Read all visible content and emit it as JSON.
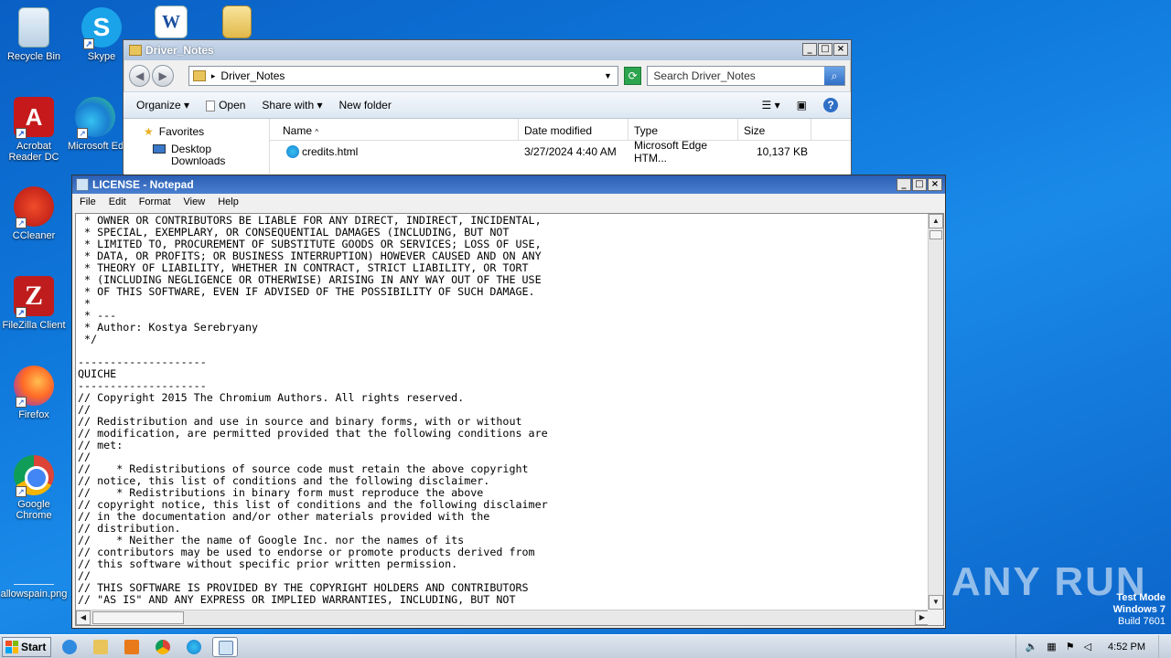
{
  "desktop": {
    "icons": [
      {
        "label": "Recycle Bin",
        "icon": "recycle-bin-icon"
      },
      {
        "label": "Skype",
        "icon": "skype-icon"
      },
      {
        "label": "Acrobat Reader DC",
        "icon": "acrobat-icon"
      },
      {
        "label": "Microsoft Edge",
        "icon": "edge-icon"
      },
      {
        "label": "CCleaner",
        "icon": "ccleaner-icon"
      },
      {
        "label": "FileZilla Client",
        "icon": "filezilla-icon"
      },
      {
        "label": "Firefox",
        "icon": "firefox-icon"
      },
      {
        "label": "Google Chrome",
        "icon": "chrome-icon"
      },
      {
        "label": "allowspain.png",
        "icon": "image-file-icon"
      }
    ],
    "edge_label_visible": "Microsoft Ed"
  },
  "explorer": {
    "title": "Driver_Notes",
    "address": "Driver_Notes",
    "search_placeholder": "Search Driver_Notes",
    "toolbar": {
      "organize": "Organize",
      "open": "Open",
      "share_with": "Share with",
      "new_folder": "New folder"
    },
    "nav": {
      "favorites": "Favorites",
      "desktop": "Desktop",
      "downloads": "Downloads"
    },
    "columns": {
      "name": "Name",
      "date_modified": "Date modified",
      "type": "Type",
      "size": "Size"
    },
    "files": [
      {
        "name": "credits.html",
        "date": "3/27/2024 4:40 AM",
        "type": "Microsoft Edge HTM...",
        "size": "10,137 KB"
      }
    ]
  },
  "notepad": {
    "title": "LICENSE - Notepad",
    "menu": {
      "file": "File",
      "edit": "Edit",
      "format": "Format",
      "view": "View",
      "help": "Help"
    },
    "content": " * OWNER OR CONTRIBUTORS BE LIABLE FOR ANY DIRECT, INDIRECT, INCIDENTAL,\n * SPECIAL, EXEMPLARY, OR CONSEQUENTIAL DAMAGES (INCLUDING, BUT NOT\n * LIMITED TO, PROCUREMENT OF SUBSTITUTE GOODS OR SERVICES; LOSS OF USE,\n * DATA, OR PROFITS; OR BUSINESS INTERRUPTION) HOWEVER CAUSED AND ON ANY\n * THEORY OF LIABILITY, WHETHER IN CONTRACT, STRICT LIABILITY, OR TORT\n * (INCLUDING NEGLIGENCE OR OTHERWISE) ARISING IN ANY WAY OUT OF THE USE\n * OF THIS SOFTWARE, EVEN IF ADVISED OF THE POSSIBILITY OF SUCH DAMAGE.\n *\n * ---\n * Author: Kostya Serebryany\n */\n\n--------------------\nQUICHE\n--------------------\n// Copyright 2015 The Chromium Authors. All rights reserved.\n//\n// Redistribution and use in source and binary forms, with or without\n// modification, are permitted provided that the following conditions are\n// met:\n//\n//    * Redistributions of source code must retain the above copyright\n// notice, this list of conditions and the following disclaimer.\n//    * Redistributions in binary form must reproduce the above\n// copyright notice, this list of conditions and the following disclaimer\n// in the documentation and/or other materials provided with the\n// distribution.\n//    * Neither the name of Google Inc. nor the names of its\n// contributors may be used to endorse or promote products derived from\n// this software without specific prior written permission.\n//\n// THIS SOFTWARE IS PROVIDED BY THE COPYRIGHT HOLDERS AND CONTRIBUTORS\n// \"AS IS\" AND ANY EXPRESS OR IMPLIED WARRANTIES, INCLUDING, BUT NOT"
  },
  "watermark": "ANY RUN",
  "os_info": {
    "line1": "Test Mode",
    "line2": "Windows 7",
    "line3": "Build 7601"
  },
  "taskbar": {
    "start": "Start",
    "clock": "4:52 PM"
  },
  "colors": {
    "desktop": "#0f79dc",
    "notepad_title": "#2a5fb4"
  }
}
